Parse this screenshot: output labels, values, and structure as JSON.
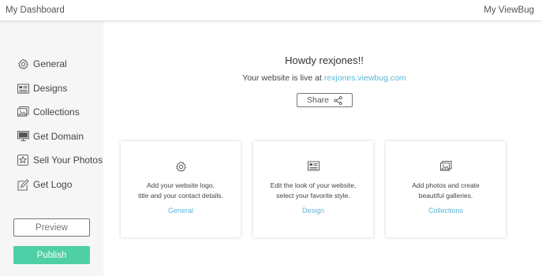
{
  "topbar": {
    "dashboard_label": "My Dashboard",
    "viewbug_label": "My ViewBug"
  },
  "sidebar": {
    "items": [
      {
        "label": "General",
        "icon": "gear-icon"
      },
      {
        "label": "Designs",
        "icon": "layout-icon"
      },
      {
        "label": "Collections",
        "icon": "photos-icon"
      },
      {
        "label": "Get Domain",
        "icon": "monitor-icon"
      },
      {
        "label": "Sell Your Photos",
        "icon": "star-tag-icon"
      },
      {
        "label": "Get Logo",
        "icon": "pencil-icon"
      }
    ],
    "preview_label": "Preview",
    "publish_label": "Publish"
  },
  "main": {
    "greeting": "Howdy rexjones!!",
    "live_prefix": "Your website is live at ",
    "site_url": "rexjones.viewbug.com",
    "share_label": "Share",
    "cards": [
      {
        "line1": "Add your website logo,",
        "line2": "title and your contact details.",
        "link": "General",
        "icon": "gear-icon"
      },
      {
        "line1": "Edit the look of your website,",
        "line2": "select your favorite style.",
        "link": "Design",
        "icon": "layout-icon"
      },
      {
        "line1": "Add photos and create",
        "line2": "beautiful galleries.",
        "link": "Collections",
        "icon": "photos-icon"
      }
    ]
  },
  "colors": {
    "accent_link": "#5cb7d8",
    "publish_green": "#4fcfa5",
    "sidebar_bg": "#f6f6f6"
  }
}
